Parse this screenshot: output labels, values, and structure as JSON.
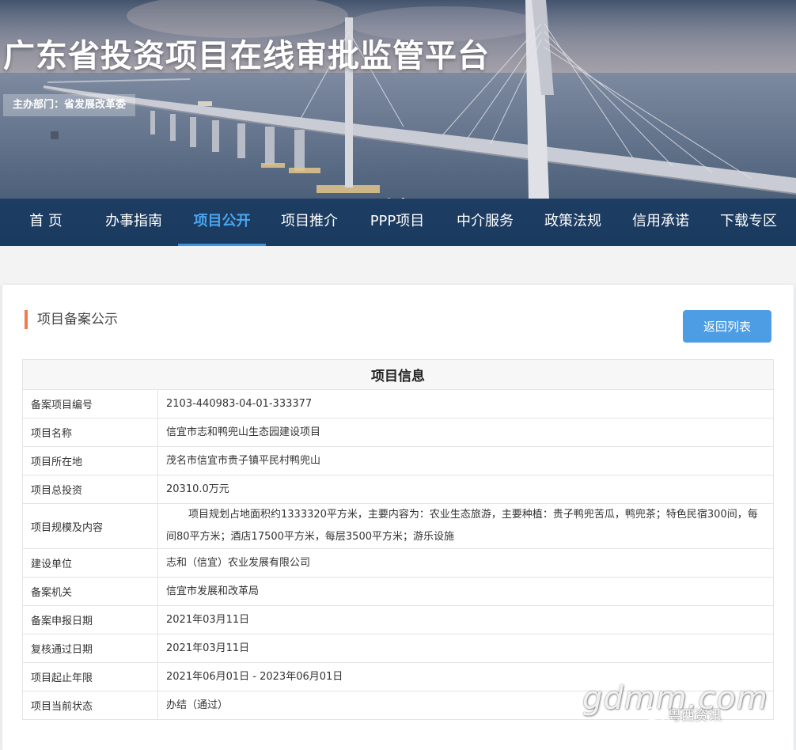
{
  "banner": {
    "title": "广东省投资项目在线审批监管平台",
    "sponsor": "主办部门：省发展改革委"
  },
  "nav": {
    "items": [
      "首 页",
      "办事指南",
      "项目公开",
      "项目推介",
      "PPP项目",
      "中介服务",
      "政策法规",
      "信用承诺",
      "下载专区"
    ],
    "active": "项目公开"
  },
  "page": {
    "section_title": "项目备案公示",
    "back_button": "返回列表"
  },
  "table": {
    "header": "项目信息",
    "rows": [
      {
        "label": "备案项目编号",
        "value": "2103-440983-04-01-333377"
      },
      {
        "label": "项目名称",
        "value": "信宜市志和鸭兜山生态园建设项目"
      },
      {
        "label": "项目所在地",
        "value": "茂名市信宜市贵子镇平民村鸭兜山"
      },
      {
        "label": "项目总投资",
        "value": "20310.0万元"
      },
      {
        "label": "项目规模及内容",
        "value": "项目规划占地面积约1333320平方米，主要内容为：农业生态旅游，主要种植：贵子鸭兜苦瓜，鸭兜茶；特色民宿300间，每间80平方米；酒店17500平方米，每层3500平方米；游乐设施"
      },
      {
        "label": "建设单位",
        "value": "志和（信宜）农业发展有限公司"
      },
      {
        "label": "备案机关",
        "value": "信宜市发展和改革局"
      },
      {
        "label": "备案申报日期",
        "value": "2021年03月11日"
      },
      {
        "label": "复核通过日期",
        "value": "2021年03月11日"
      },
      {
        "label": "项目起止年限",
        "value": "2021年06月01日 - 2023年06月01日"
      },
      {
        "label": "项目当前状态",
        "value": "办结（通过）"
      }
    ]
  },
  "watermark": {
    "logo": "gdmm.com",
    "account": "粤西资讯",
    "icon": "wechat-icon"
  }
}
